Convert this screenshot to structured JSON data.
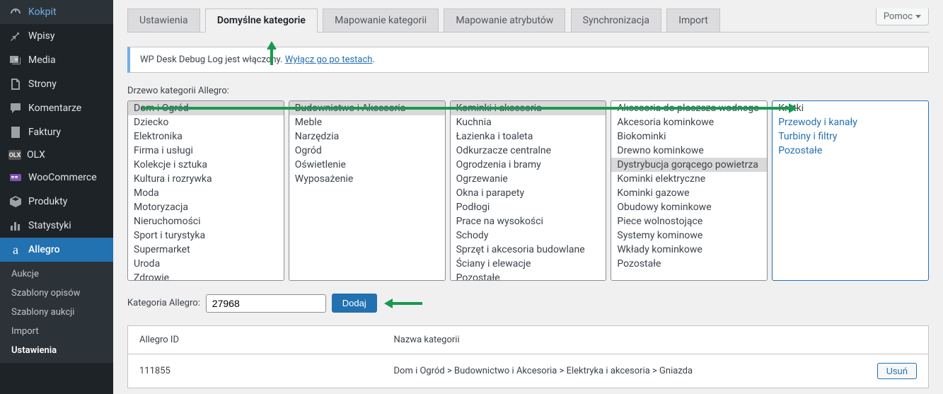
{
  "sidebar": {
    "items": [
      {
        "label": "Kokpit",
        "name": "sidebar-item-dashboard",
        "icon": "dashboard"
      },
      {
        "label": "Wpisy",
        "name": "sidebar-item-posts",
        "icon": "pin"
      },
      {
        "label": "Media",
        "name": "sidebar-item-media",
        "icon": "media"
      },
      {
        "label": "Strony",
        "name": "sidebar-item-pages",
        "icon": "pages"
      },
      {
        "label": "Komentarze",
        "name": "sidebar-item-comments",
        "icon": "comment"
      },
      {
        "label": "Faktury",
        "name": "sidebar-item-invoices",
        "icon": "invoice"
      },
      {
        "label": "OLX",
        "name": "sidebar-item-olx",
        "icon": "olx"
      },
      {
        "label": "WooCommerce",
        "name": "sidebar-item-woocommerce",
        "icon": "woo"
      },
      {
        "label": "Produkty",
        "name": "sidebar-item-products",
        "icon": "box"
      },
      {
        "label": "Statystyki",
        "name": "sidebar-item-stats",
        "icon": "bars"
      },
      {
        "label": "Allegro",
        "name": "sidebar-item-allegro",
        "icon": "a",
        "active": true
      }
    ],
    "sub": [
      {
        "label": "Aukcje",
        "name": "sidebar-sub-auctions"
      },
      {
        "label": "Szablony opisów",
        "name": "sidebar-sub-desc-templates"
      },
      {
        "label": "Szablony aukcji",
        "name": "sidebar-sub-auction-templates"
      },
      {
        "label": "Import",
        "name": "sidebar-sub-import"
      },
      {
        "label": "Ustawienia",
        "name": "sidebar-sub-settings",
        "active": true
      }
    ]
  },
  "help_label": "Pomoc",
  "tabs": [
    {
      "label": "Ustawienia",
      "name": "tab-settings"
    },
    {
      "label": "Domyślne kategorie",
      "name": "tab-default-categories",
      "active": true
    },
    {
      "label": "Mapowanie kategorii",
      "name": "tab-category-mapping"
    },
    {
      "label": "Mapowanie atrybutów",
      "name": "tab-attribute-mapping"
    },
    {
      "label": "Synchronizacja",
      "name": "tab-sync"
    },
    {
      "label": "Import",
      "name": "tab-import"
    }
  ],
  "notice": {
    "text": "WP Desk Debug Log jest włączony. ",
    "link": "Wyłącz go po testach",
    "suffix": "."
  },
  "tree_label": "Drzewo kategorii Allegro:",
  "tree": [
    {
      "name": "tree-col-1",
      "options": [
        {
          "label": "Dom i Ogród",
          "selected": true
        },
        {
          "label": "Dziecko"
        },
        {
          "label": "Elektronika"
        },
        {
          "label": "Firma i usługi"
        },
        {
          "label": "Kolekcje i sztuka"
        },
        {
          "label": "Kultura i rozrywka"
        },
        {
          "label": "Moda"
        },
        {
          "label": "Motoryzacja"
        },
        {
          "label": "Nieruchomości"
        },
        {
          "label": "Sport i turystyka"
        },
        {
          "label": "Supermarket"
        },
        {
          "label": "Uroda"
        },
        {
          "label": "Zdrowie"
        }
      ]
    },
    {
      "name": "tree-col-2",
      "options": [
        {
          "label": "Budownictwo i Akcesoria",
          "selected": true
        },
        {
          "label": "Meble"
        },
        {
          "label": "Narzędzia"
        },
        {
          "label": "Ogród"
        },
        {
          "label": "Oświetlenie"
        },
        {
          "label": "Wyposażenie"
        }
      ]
    },
    {
      "name": "tree-col-3",
      "options": [
        {
          "label": "Kominki i akcesoria",
          "selected": true
        },
        {
          "label": "Kuchnia"
        },
        {
          "label": "Łazienka i toaleta"
        },
        {
          "label": "Odkurzacze centralne"
        },
        {
          "label": "Ogrodzenia i bramy"
        },
        {
          "label": "Ogrzewanie"
        },
        {
          "label": "Okna i parapety"
        },
        {
          "label": "Podłogi"
        },
        {
          "label": "Prace na wysokości"
        },
        {
          "label": "Schody"
        },
        {
          "label": "Sprzęt i akcesoria budowlane"
        },
        {
          "label": "Ściany i elewacje"
        },
        {
          "label": "Pozostałe"
        }
      ]
    },
    {
      "name": "tree-col-4",
      "options": [
        {
          "label": "Akcesoria do płaszcza wodnego"
        },
        {
          "label": "Akcesoria kominkowe"
        },
        {
          "label": "Biokominki"
        },
        {
          "label": "Drewno kominkowe"
        },
        {
          "label": "Dystrybucja gorącego powietrza",
          "selected": true
        },
        {
          "label": "Kominki elektryczne"
        },
        {
          "label": "Kominki gazowe"
        },
        {
          "label": "Obudowy kominkowe"
        },
        {
          "label": "Piece wolnostojące"
        },
        {
          "label": "Systemy kominowe"
        },
        {
          "label": "Wkłady kominkowe"
        },
        {
          "label": "Pozostałe"
        }
      ]
    },
    {
      "name": "tree-col-5",
      "final": true,
      "options": [
        {
          "label": "Kratki"
        },
        {
          "label": "Przewody i kanały",
          "link": true
        },
        {
          "label": "Turbiny i filtry",
          "link": true
        },
        {
          "label": "Pozostałe",
          "link": true
        }
      ]
    }
  ],
  "category_input": {
    "label": "Kategoria Allegro:",
    "value": "27968",
    "button": "Dodaj"
  },
  "table": {
    "headers": {
      "id": "Allegro ID",
      "name": "Nazwa kategorii",
      "actions": ""
    },
    "rows": [
      {
        "id": "111855",
        "name": "Dom i Ogród > Budownictwo i Akcesoria > Elektryka i akcesoria > Gniazda",
        "action": "Usuń"
      }
    ]
  }
}
